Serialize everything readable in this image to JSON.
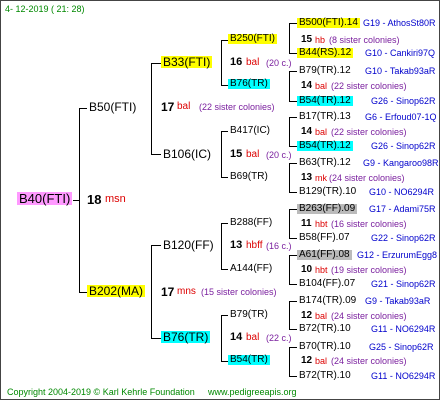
{
  "header": {
    "date": "4- 12-2019 (  21: 28)"
  },
  "colors": {
    "yellow": "#ffff00",
    "cyan": "#00ffff",
    "highlight_pink": "#ff99ff",
    "grey_box": "#bbbbbb",
    "line": "#000000",
    "red": "#dd0000",
    "blue": "#0000cc",
    "purple": "#7a1f9e",
    "green": "#008800"
  },
  "root": {
    "label": "B40(FTI)",
    "count": "18",
    "type": "msn"
  },
  "gen1": [
    {
      "label": "B50(FTI)",
      "count": "17",
      "type": "bal",
      "sisters": "(22 sister colonies)"
    },
    {
      "label": "B202(MA)",
      "count": "17",
      "type": "mns",
      "sisters": "(15 sister colonies)"
    }
  ],
  "gen2": [
    {
      "label": "B33(FTI)",
      "count": "16",
      "type": "bal",
      "sisters": "(20 c.)"
    },
    {
      "label": "B106(IC)",
      "count": "15",
      "type": "bal",
      "sisters": "(20 c.)"
    },
    {
      "label": "B120(FF)",
      "count": "13",
      "type": "hbff",
      "sisters": "(16 c.)"
    },
    {
      "label": "B76(TR)",
      "count": "14",
      "type": "bal",
      "sisters": "(22 c.)"
    }
  ],
  "gen3": [
    {
      "label": "B250(FTI)",
      "count": "15",
      "type": "hb",
      "sisters": "(8 sister colonies)"
    },
    {
      "label": "B76(TR)",
      "count": "14",
      "type": "bal",
      "sisters": "(22 sister colonies)"
    },
    {
      "label": "B417(IC)",
      "count": "14",
      "type": "bal",
      "sisters": "(22 sister colonies)"
    },
    {
      "label": "B69(TR)",
      "count": "13",
      "type": "mk",
      "sisters": "(24 sister colonies)"
    },
    {
      "label": "B288(FF)",
      "count": "11",
      "type": "hbt",
      "sisters": "(16 sister colonies)"
    },
    {
      "label": "A144(FF)",
      "count": "10",
      "type": "hbt",
      "sisters": "(19 sister colonies)"
    },
    {
      "label": "B79(TR)",
      "count": "12",
      "type": "bal",
      "sisters": "(24 sister colonies)"
    },
    {
      "label": "B54(TR)",
      "count": "12",
      "type": "bal",
      "sisters": "(24 sister colonies)"
    }
  ],
  "gen4": [
    {
      "label": "B500(FTI).14",
      "line": "G19 - AthosSt80R"
    },
    {
      "label": "B44(RS).12",
      "line": "G10 - Cankiri97Q"
    },
    {
      "label": "B79(TR).12",
      "line": "G10 - Takab93aR"
    },
    {
      "label": "B54(TR).12",
      "line": "G26 - Sinop62R"
    },
    {
      "label": "B17(TR).13",
      "line": "G6 - Erfoud07-1Q"
    },
    {
      "label": "B54(TR).12",
      "line": "G26 - Sinop62R"
    },
    {
      "label": "B63(TR).12",
      "line": "G9 - Kangaroo98R"
    },
    {
      "label": "B129(TR).10",
      "line": "G10 - NO6294R"
    },
    {
      "label": "B263(FF).09",
      "line": "G17 - Adami75R"
    },
    {
      "label": "B58(FF).07",
      "line": "G22 - Sinop62R"
    },
    {
      "label": "A61(FF).08",
      "line": "G12 - ErzurumEgg8"
    },
    {
      "label": "B104(FF).07",
      "line": "G21 - Sinop62R"
    },
    {
      "label": "B174(TR).09",
      "line": "G9 - Takab93aR"
    },
    {
      "label": "B72(TR).10",
      "line": "G11 - NO6294R"
    },
    {
      "label": "B70(TR).10",
      "line": "G25 - Sinop62R"
    },
    {
      "label": "B72(TR).10",
      "line": "G11 - NO6294R"
    }
  ],
  "footer": {
    "copyright": "Copyright 2004-2019 © Karl Kehrle Foundation",
    "site": "www.pedigreeapis.org"
  }
}
